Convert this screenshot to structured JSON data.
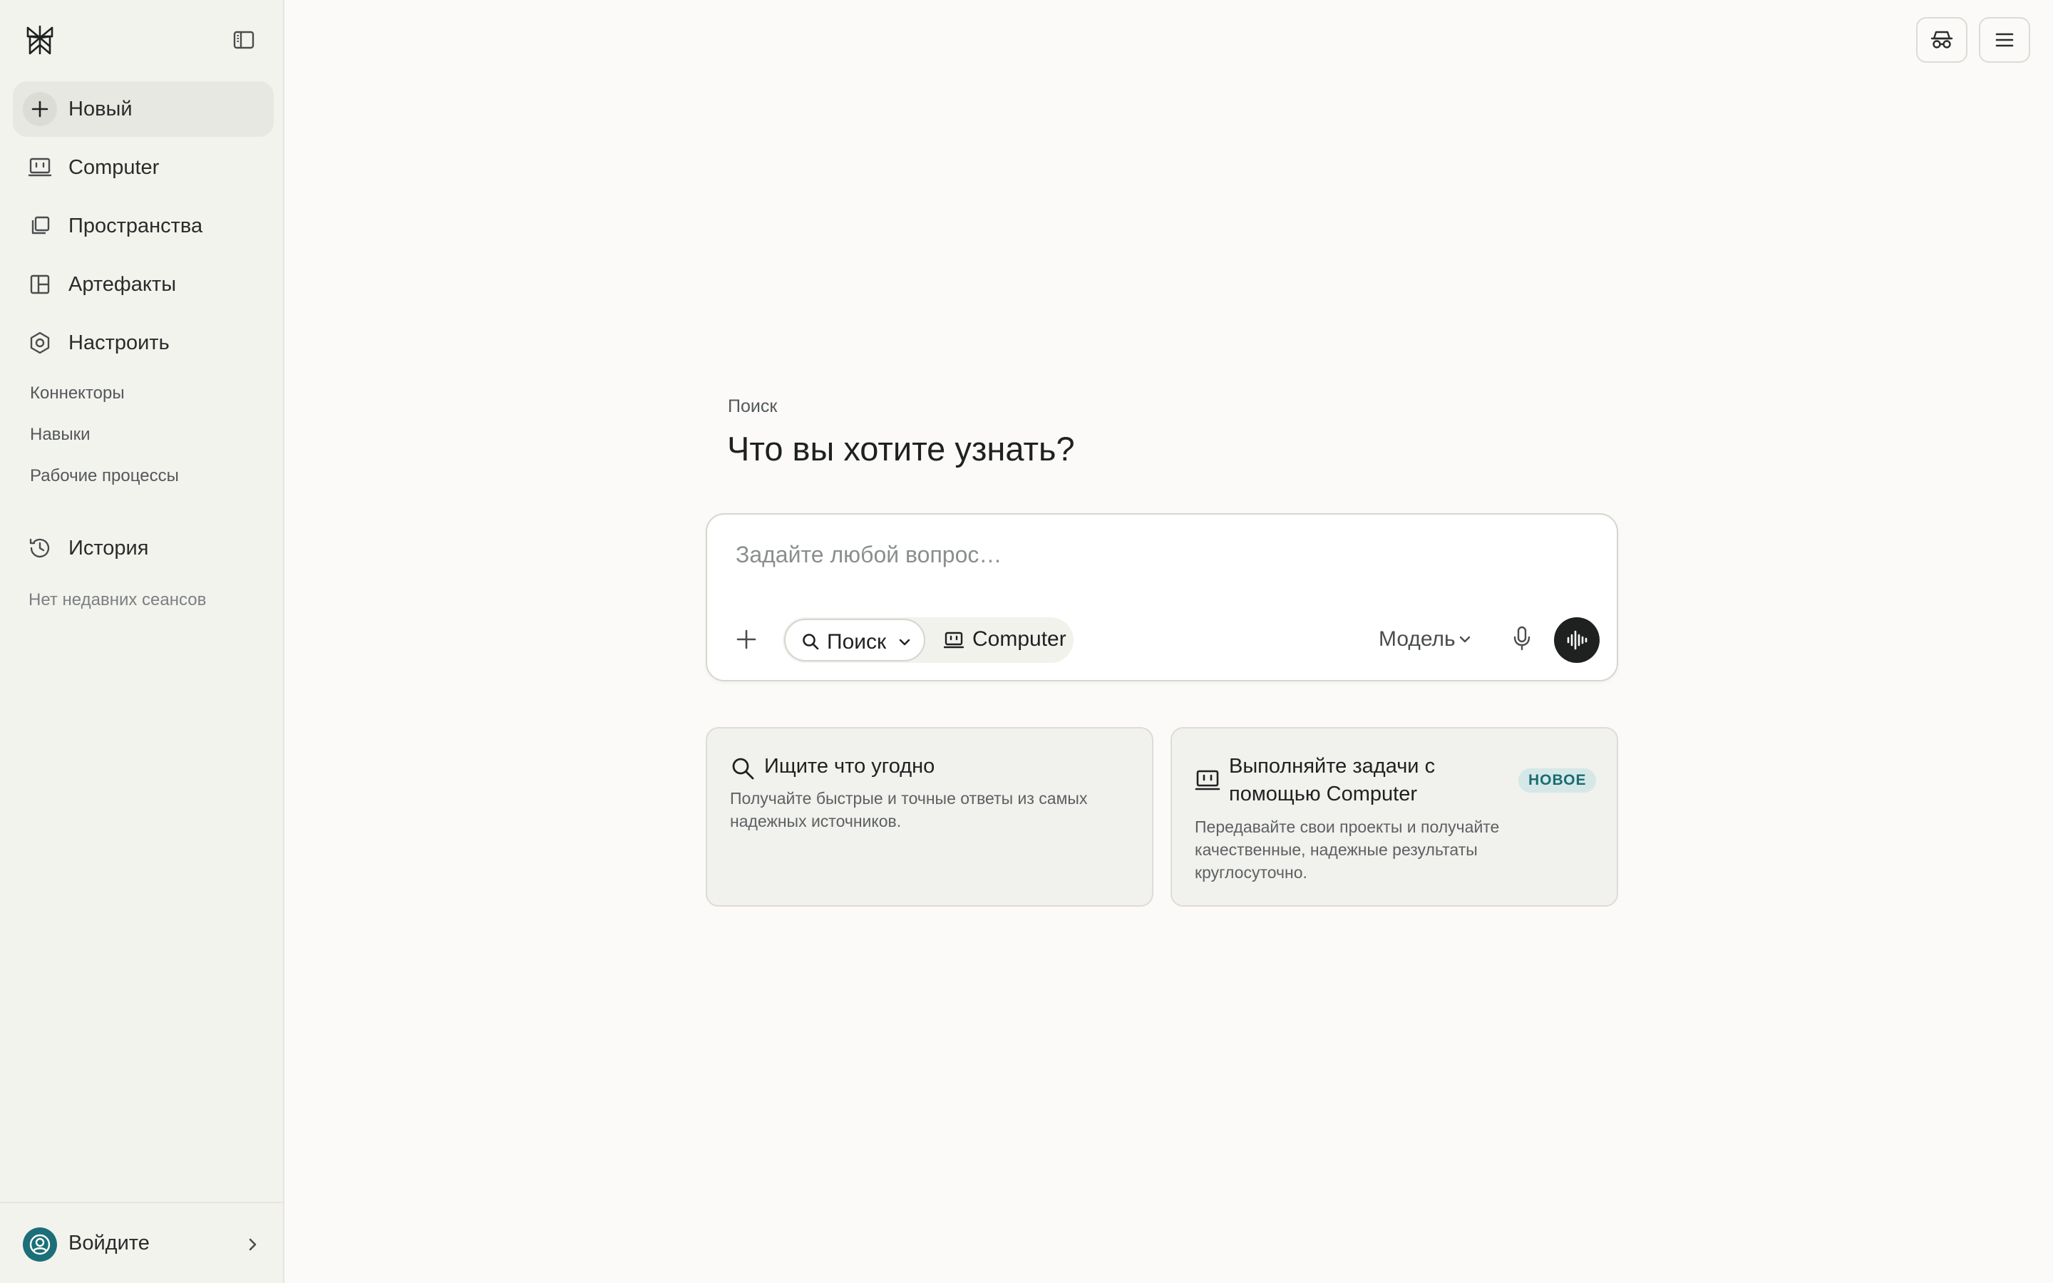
{
  "sidebar": {
    "items": [
      {
        "label": "Новый",
        "icon": "plus-icon"
      },
      {
        "label": "Computer",
        "icon": "computer-icon"
      },
      {
        "label": "Пространства",
        "icon": "spaces-icon"
      },
      {
        "label": "Артефакты",
        "icon": "artifacts-icon"
      },
      {
        "label": "Настроить",
        "icon": "customize-icon"
      }
    ],
    "sub_items": [
      "Коннекторы",
      "Навыки",
      "Рабочие процессы"
    ],
    "history": {
      "label": "История",
      "empty_text": "Нет недавних сеансов"
    },
    "footer": {
      "signin_label": "Войдите"
    }
  },
  "main": {
    "eyebrow": "Поиск",
    "headline": "Что вы хотите узнать?",
    "composer": {
      "placeholder": "Задайте любой вопрос…",
      "mode_search_label": "Поиск",
      "mode_computer_label": "Computer",
      "model_label": "Модель"
    },
    "cards": [
      {
        "title": "Ищите что угодно",
        "description_lines": [
          "Получайте быстрые и точные ответы из самых",
          "надежных источников."
        ]
      },
      {
        "title_lines": [
          "Выполняйте задачи с",
          "помощью Computer"
        ],
        "badge": "НОВОЕ",
        "description_lines": [
          "Передавайте свои проекты и получайте",
          "качественные, надежные результаты",
          "круглосуточно."
        ]
      }
    ]
  },
  "colors": {
    "accent_teal": "#1b6f78",
    "badge_bg": "#d5e8e7",
    "sidebar_bg": "#f3f3ee",
    "page_bg": "#fbfaf8"
  }
}
